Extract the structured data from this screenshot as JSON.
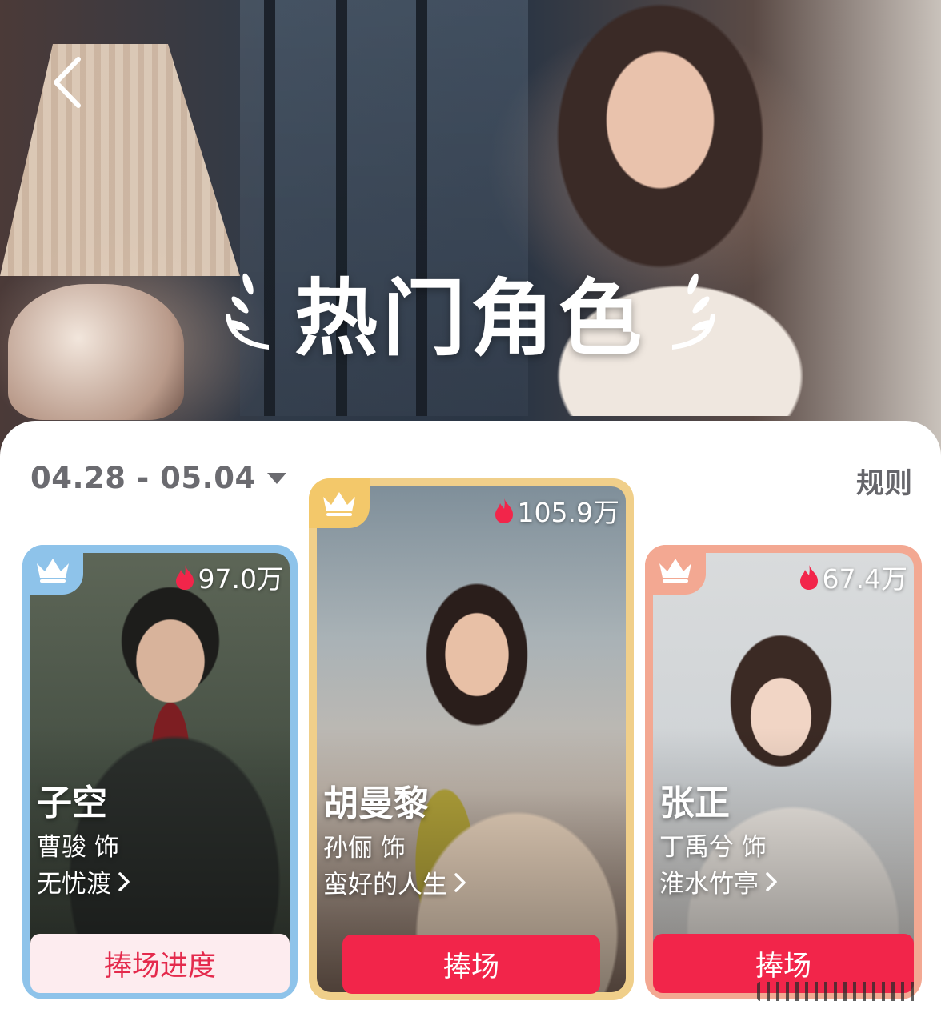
{
  "hero": {
    "title": "热门角色"
  },
  "filter": {
    "date_range": "04.28 - 05.04",
    "rules_label": "规则"
  },
  "cards": [
    {
      "rank": "2",
      "heat": "97.0万",
      "character": "子空",
      "actor": "曹骏 饰",
      "show": "无忧渡",
      "button": "捧场进度",
      "accent": "#8ec3ea"
    },
    {
      "rank": "1",
      "heat": "105.9万",
      "character": "胡曼黎",
      "actor": "孙俪 饰",
      "show": "蛮好的人生",
      "button": "捧场",
      "accent": "#f0cf8a"
    },
    {
      "rank": "3",
      "heat": "67.4万",
      "character": "张正",
      "actor": "丁禹兮 饰",
      "show": "淮水竹亭",
      "button": "捧场",
      "accent": "#f3a892"
    }
  ],
  "colors": {
    "primary_button": "#f2254a",
    "secondary_button_bg": "#fdecef",
    "secondary_button_text": "#e42a4c"
  }
}
